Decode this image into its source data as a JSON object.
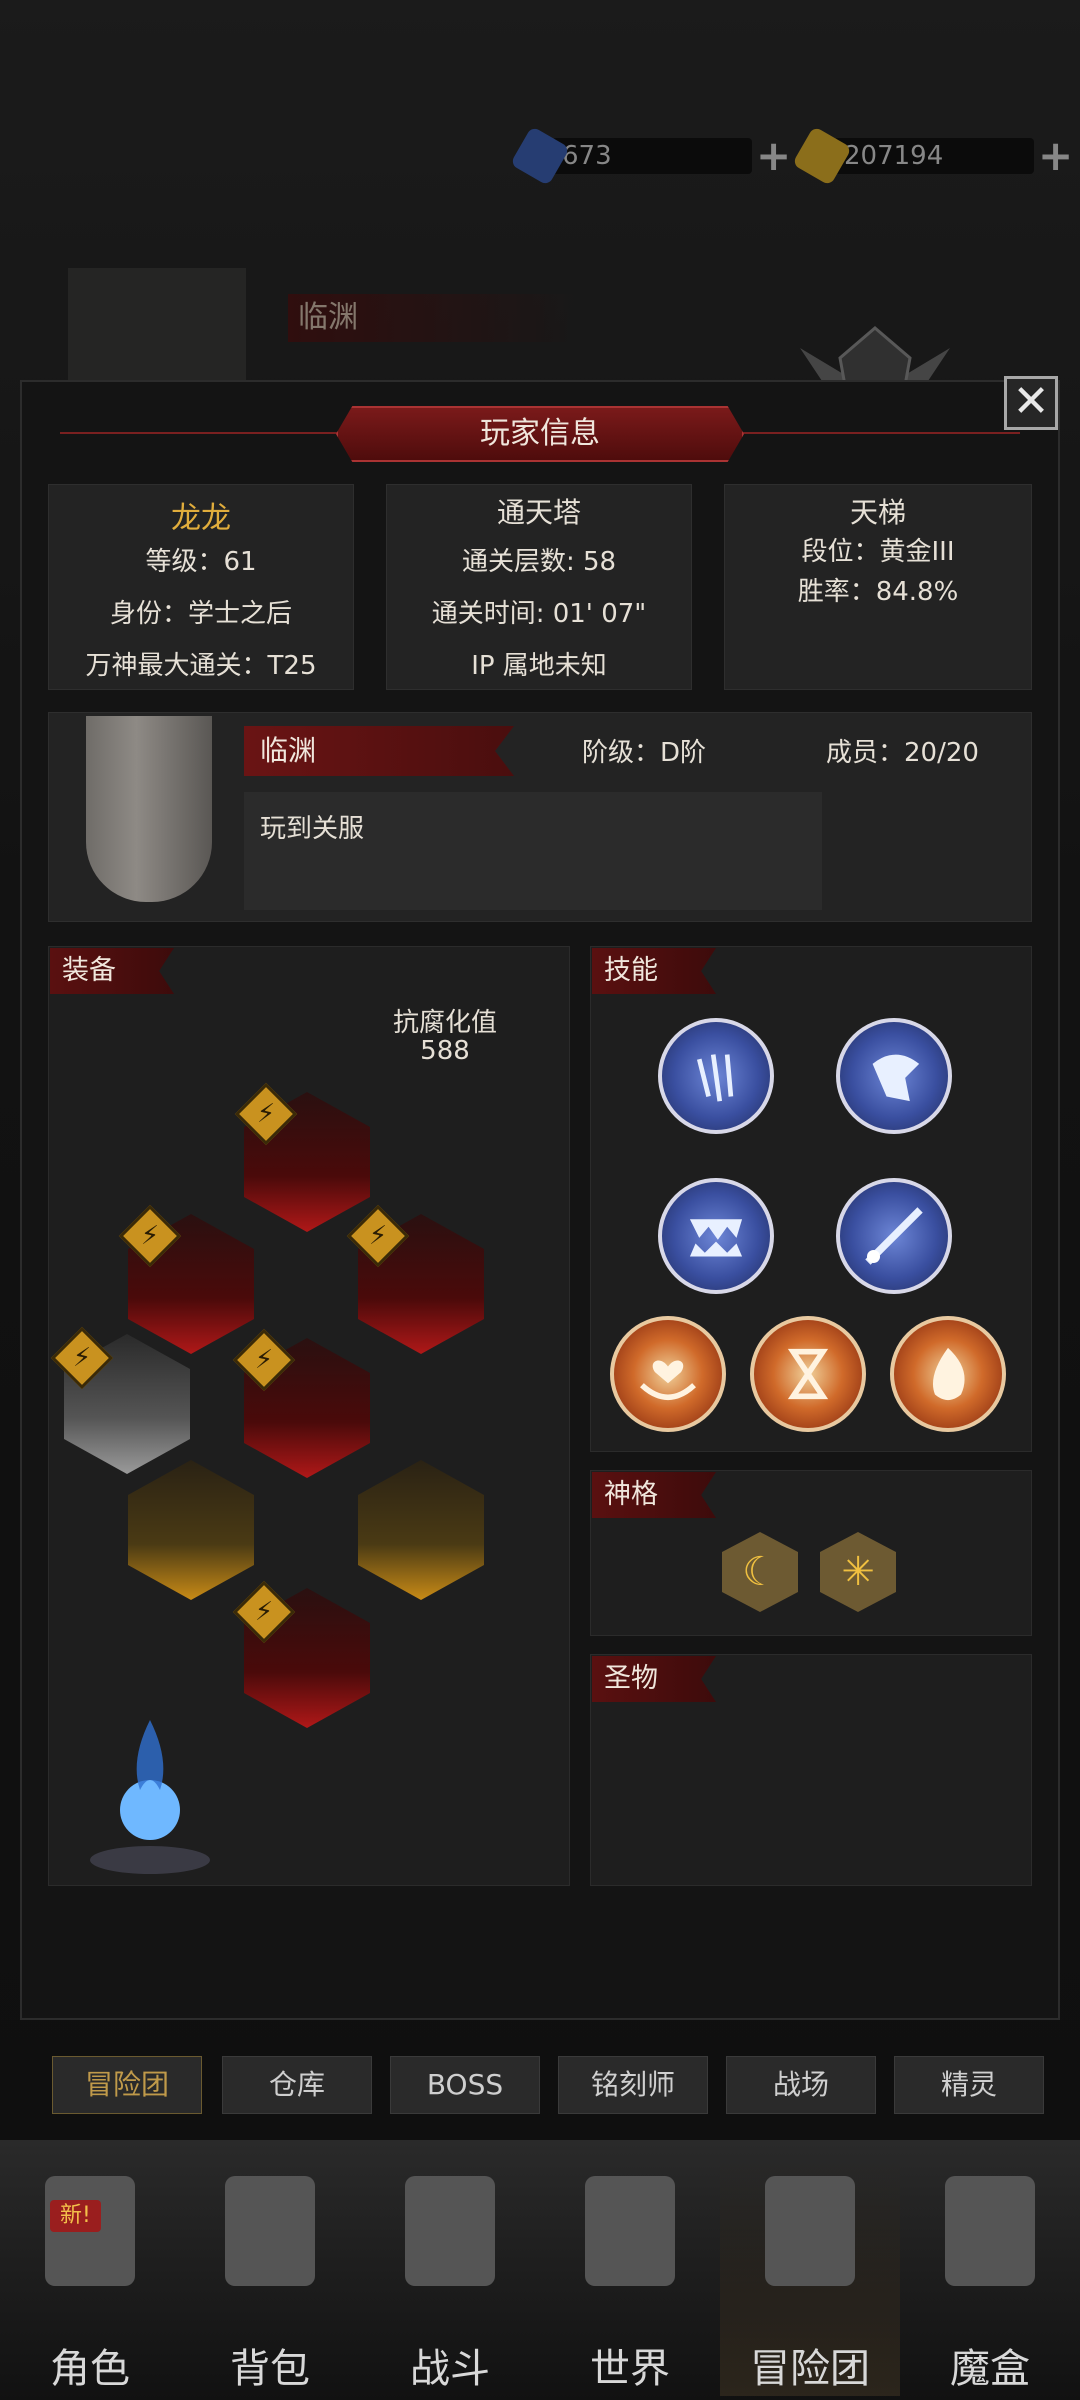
{
  "currency": {
    "gems": "673",
    "gold": "207194"
  },
  "background": {
    "player_name": "临渊"
  },
  "dialog": {
    "title": "玩家信息",
    "profile": {
      "name": "龙龙",
      "level": "等级：61",
      "identity": "身份：学士之后",
      "pantheon": "万神最大通关：T25"
    },
    "tower": {
      "title": "通天塔",
      "floors": "通关层数: 58",
      "time": "通关时间: 01' 07\"",
      "ip": "IP 属地未知"
    },
    "ladder": {
      "title": "天梯",
      "rank": "段位：黄金III",
      "winrate": "胜率：84.8%"
    },
    "guild": {
      "name": "临渊",
      "tier": "阶级：D阶",
      "members": "成员：20/20",
      "motto": "玩到关服"
    },
    "equipment": {
      "tag": "装备",
      "corruption_label": "抗腐化值",
      "corruption_value": "588"
    },
    "skills": {
      "tag": "技能"
    },
    "divinity": {
      "tag": "神格"
    },
    "relics": {
      "tag": "圣物"
    }
  },
  "subtabs": [
    "冒险团",
    "仓库",
    "BOSS",
    "铭刻师",
    "战场",
    "精灵"
  ],
  "nav": {
    "new_badge": "新!",
    "items": [
      "角色",
      "背包",
      "战斗",
      "世界",
      "冒险团",
      "魔盒"
    ]
  },
  "colors": {
    "accent_red": "#7a1a1a",
    "gold_text": "#e1ad3c",
    "badge_gold": "#c9921f"
  }
}
